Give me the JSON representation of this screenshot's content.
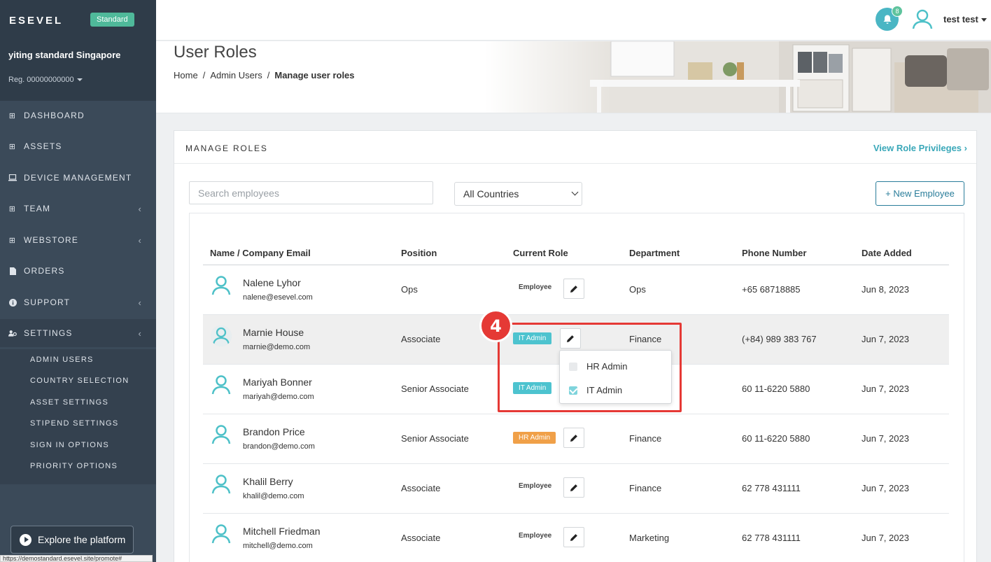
{
  "sidebar": {
    "brand": "ESEVEL",
    "plan_badge": "Standard",
    "org_name": "yiting standard Singapore",
    "reg": "Reg. 00000000000",
    "items": [
      {
        "label": "DASHBOARD",
        "icon": "grid-icon"
      },
      {
        "label": "ASSETS",
        "icon": "grid-icon"
      },
      {
        "label": "DEVICE MANAGEMENT",
        "icon": "laptop-icon"
      },
      {
        "label": "TEAM",
        "icon": "grid-icon"
      },
      {
        "label": "WEBSTORE",
        "icon": "grid-icon"
      },
      {
        "label": "ORDERS",
        "icon": "file-icon"
      },
      {
        "label": "SUPPORT",
        "icon": "info-icon"
      },
      {
        "label": "SETTINGS",
        "icon": "users-gear-icon"
      }
    ],
    "settings_sub": [
      "ADMIN USERS",
      "COUNTRY SELECTION",
      "ASSET SETTINGS",
      "STIPEND SETTINGS",
      "SIGN IN OPTIONS",
      "PRIORITY OPTIONS"
    ],
    "explore_label": "Explore the platform",
    "status_url": "https://demostandard.esevel.site/promote#"
  },
  "topbar": {
    "notification_count": "8",
    "username": "test test"
  },
  "header": {
    "title": "User Roles",
    "breadcrumb": [
      "Home",
      "Admin Users",
      "Manage user roles"
    ]
  },
  "card": {
    "title": "MANAGE ROLES",
    "view_privileges": "View Role Privileges",
    "search_placeholder": "Search employees",
    "country_filter": "All Countries",
    "new_employee": "+ New Employee"
  },
  "table": {
    "columns": [
      "Name / Company Email",
      "Position",
      "Current Role",
      "Department",
      "Phone Number",
      "Date Added"
    ],
    "rows": [
      {
        "name": "Nalene Lyhor",
        "email": "nalene@esevel.com",
        "position": "Ops",
        "role": "Employee",
        "department": "Ops",
        "phone": "+65 68718885",
        "date": "Jun 8, 2023"
      },
      {
        "name": "Marnie House",
        "email": "marnie@demo.com",
        "position": "Associate",
        "role": "IT Admin",
        "department": "Finance",
        "phone": "(+84) 989 383 767",
        "date": "Jun 7, 2023"
      },
      {
        "name": "Mariyah Bonner",
        "email": "mariyah@demo.com",
        "position": "Senior Associate",
        "role": "IT Admin",
        "department": "",
        "phone": "60 11-6220 5880",
        "date": "Jun 7, 2023"
      },
      {
        "name": "Brandon Price",
        "email": "brandon@demo.com",
        "position": "Senior Associate",
        "role": "HR Admin",
        "department": "Finance",
        "phone": "60 11-6220 5880",
        "date": "Jun 7, 2023"
      },
      {
        "name": "Khalil Berry",
        "email": "khalil@demo.com",
        "position": "Associate",
        "role": "Employee",
        "department": "Finance",
        "phone": "62 778 431111",
        "date": "Jun 7, 2023"
      },
      {
        "name": "Mitchell Friedman",
        "email": "mitchell@demo.com",
        "position": "Associate",
        "role": "Employee",
        "department": "Marketing",
        "phone": "62 778 431111",
        "date": "Jun 7, 2023"
      }
    ]
  },
  "role_dropdown": {
    "options": [
      {
        "label": "HR Admin",
        "checked": false
      },
      {
        "label": "IT Admin",
        "checked": true
      }
    ]
  },
  "step_badge": "4",
  "colors": {
    "sidebar": "#3b4a59",
    "accent": "#3aa8b9",
    "it_admin": "#4dc3cf",
    "hr_admin": "#f0a048",
    "highlight": "#e53935"
  }
}
